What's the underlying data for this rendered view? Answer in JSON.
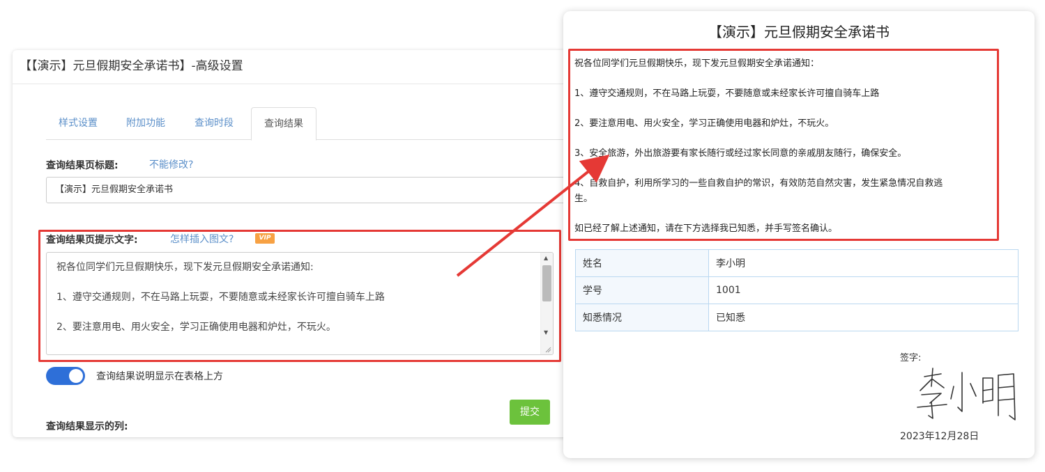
{
  "settings": {
    "window_title": "【【演示】元旦假期安全承诺书】-高级设置",
    "tabs": [
      {
        "label": "样式设置"
      },
      {
        "label": "附加功能"
      },
      {
        "label": "查询时段"
      },
      {
        "label": "查询结果",
        "active": true
      }
    ],
    "result_title_label": "查询结果页标题:",
    "result_title_help": "不能修改?",
    "result_title_value": "【演示】元旦假期安全承诺书",
    "prompt_text_label": "查询结果页提示文字:",
    "prompt_text_help": "怎样插入图文?",
    "vip_badge": "VIP",
    "prompt_text_lines": [
      "祝各位同学们元旦假期快乐，现下发元旦假期安全承诺通知:",
      "1、遵守交通规则，不在马路上玩耍，不要随意或未经家长许可擅自骑车上路",
      "2、要注意用电、用火安全，学习正确使用电器和炉灶，不玩火。"
    ],
    "toggle_label": "查询结果说明显示在表格上方",
    "toggle_on": true,
    "submit_label": "提交",
    "columns_label": "查询结果显示的列:"
  },
  "preview": {
    "title": "【演示】元旦假期安全承诺书",
    "notice_lines": [
      "祝各位同学们元旦假期快乐，现下发元旦假期安全承诺通知：",
      "1、遵守交通规则，不在马路上玩耍，不要随意或未经家长许可擅自骑车上路",
      "2、要注意用电、用火安全，学习正确使用电器和炉灶，不玩火。",
      "3、安全旅游，外出旅游要有家长随行或经过家长同意的亲戚朋友随行，确保安全。",
      "4、自救自护，利用所学习的一些自救自护的常识，有效防范自然灾害，发生紧急情况自救逃",
      "生。",
      "如已经了解上述通知，请在下方选择我已知悉，并手写签名确认。"
    ],
    "table": [
      {
        "key": "姓名",
        "value": "李小明"
      },
      {
        "key": "学号",
        "value": "1001"
      },
      {
        "key": "知悉情况",
        "value": "已知悉"
      }
    ],
    "signature_label": "签字:",
    "signature_text": "李小明",
    "date": "2023年12月28日"
  },
  "colors": {
    "highlight": "#e53935",
    "link": "#5b8fc9",
    "toggle": "#2e6fd8",
    "submit": "#6cc23c",
    "vip": "#f7a143"
  },
  "icons": [
    "arrow-annotation",
    "scroll-up-icon",
    "scroll-down-icon",
    "resize-grip-icon"
  ]
}
